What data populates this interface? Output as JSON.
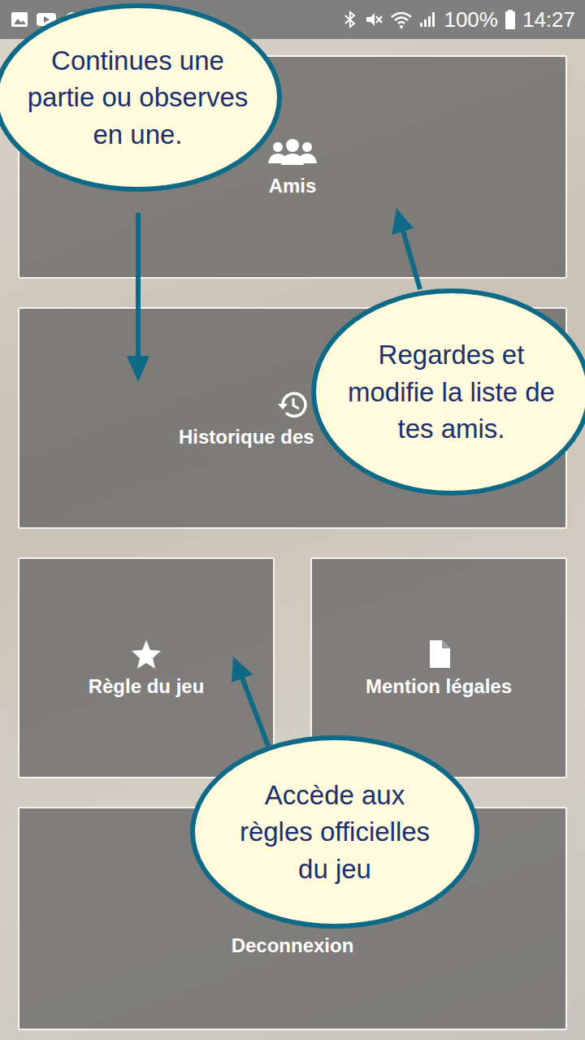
{
  "status_bar": {
    "battery": "100%",
    "time": "14:27"
  },
  "tiles": [
    {
      "label": "Amis",
      "kind": "friends"
    },
    {
      "label": "Historique des",
      "kind": "history"
    },
    {
      "label": "Règle du jeu",
      "kind": "rules"
    },
    {
      "label": "Mention légales",
      "kind": "legal"
    },
    {
      "label": "Deconnexion",
      "kind": "logout"
    }
  ],
  "tutorial_bubbles": [
    {
      "lines": [
        "Continues une",
        "partie ou observes",
        "en une."
      ]
    },
    {
      "lines": [
        "Regardes et",
        "modifie la liste de",
        "tes amis."
      ]
    },
    {
      "lines": [
        "Accède aux",
        "règles officielles",
        "du jeu"
      ]
    }
  ]
}
